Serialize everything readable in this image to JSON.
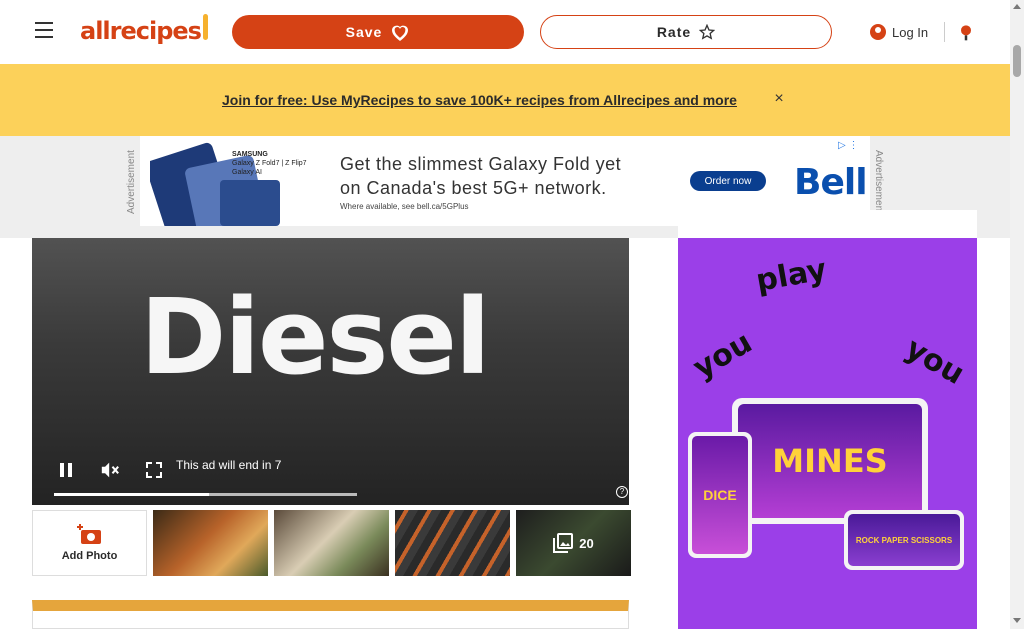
{
  "header": {
    "logo_text": "allrecipes",
    "save_label": "Save",
    "rate_label": "Rate",
    "login_label": "Log In"
  },
  "banner": {
    "link_text": "Join for free: Use MyRecipes to save 100K+ recipes from Allrecipes and more",
    "close_symbol": "×"
  },
  "ad_strip": {
    "label": "Advertisement",
    "brand_top": "SAMSUNG",
    "product_line1": "Galaxy Z Fold7 | Z Flip7",
    "product_line2": "Galaxy AI",
    "headline_line1": "Get the slimmest Galaxy Fold yet",
    "headline_line2": "on Canada's best 5G+ network.",
    "fineprint": "Where available, see bell.ca/5GPlus",
    "cta": "Order now",
    "brand": "Bell"
  },
  "video": {
    "title": "Diesel",
    "status_text": "This ad will end in 7",
    "progress": 0.51,
    "help_symbol": "?"
  },
  "gallery": {
    "add_photo_label": "Add Photo",
    "more_count": "20"
  },
  "side_ad": {
    "words": [
      "play",
      "you",
      "you"
    ],
    "game1": "DICE",
    "game2": "MINES",
    "game3": "ROCK PAPER SCISSORS"
  },
  "colors": {
    "brand": "#d54215",
    "banner": "#fcd15a",
    "accent_bar": "#e5a53c",
    "side_ad_bg": "#9b3fe8"
  }
}
